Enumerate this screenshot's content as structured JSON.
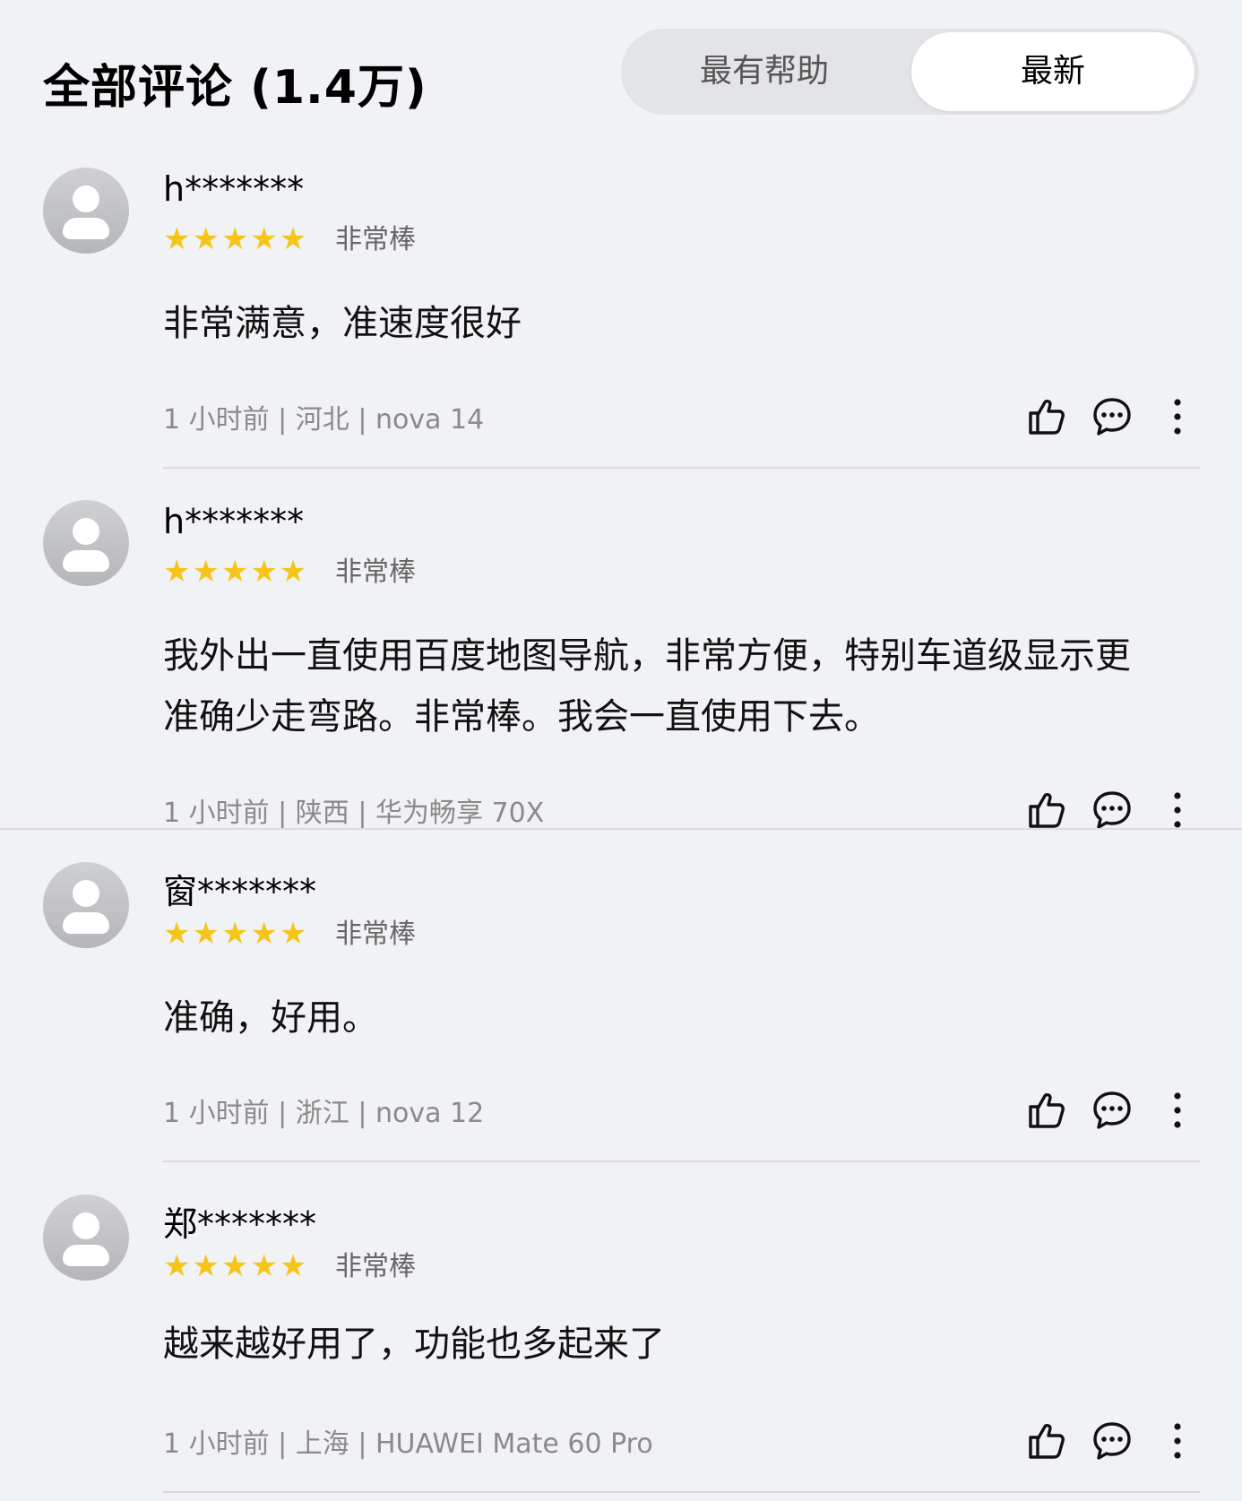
{
  "header": {
    "title": "全部评论 (1.4万)",
    "tabs": [
      {
        "label": "最有帮助",
        "active": false
      },
      {
        "label": "最新",
        "active": true
      }
    ]
  },
  "reviews": [
    {
      "user": "h*******",
      "stars": "★★★★★",
      "rating_label": "非常棒",
      "lines": [
        "非常满意，准速度很好"
      ],
      "meta": "1 小时前 | 河北 | nova 14"
    },
    {
      "user": "h*******",
      "stars": "★★★★★",
      "rating_label": "非常棒",
      "lines": [
        "我外出一直使用百度地图导航，非常方便，特别车道级显示更",
        "准确少走弯路。非常棒。我会一直使用下去。"
      ],
      "meta": "1 小时前 | 陕西 | 华为畅享 70X"
    },
    {
      "user": "窗*******",
      "stars": "★★★★★",
      "rating_label": "非常棒",
      "lines": [
        "准确，好用。"
      ],
      "meta": "1 小时前 | 浙江 | nova 12"
    },
    {
      "user": "郑*******",
      "stars": "★★★★★",
      "rating_label": "非常棒",
      "lines": [
        "越来越好用了，功能也多起来了"
      ],
      "meta": "1 小时前 | 上海 | HUAWEI Mate 60 Pro"
    }
  ],
  "icons": {
    "like": "thumbs-up-icon",
    "comment": "comment-icon",
    "more": "more-vertical-icon"
  },
  "colors": {
    "background": "#f1f2f5",
    "star": "#f6c51a",
    "meta_text": "#8a8a8a"
  }
}
